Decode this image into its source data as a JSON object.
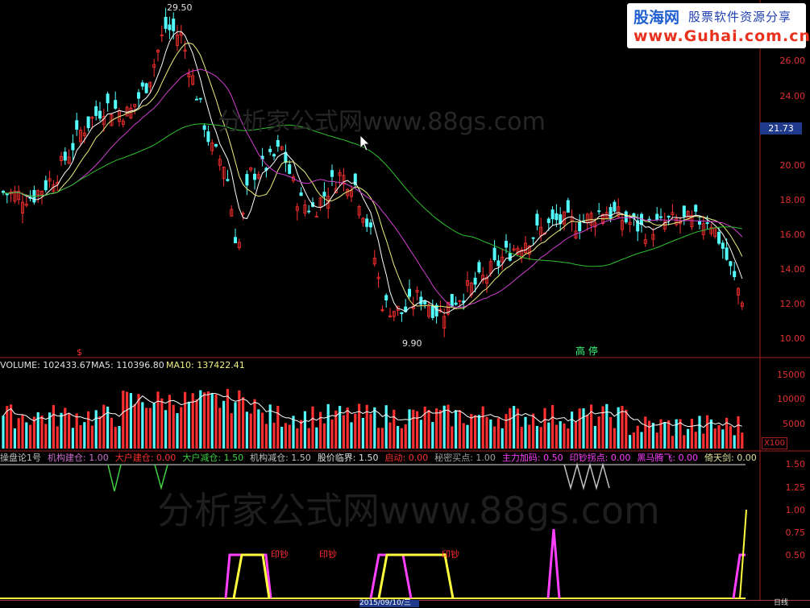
{
  "logo": {
    "brand": "股海网",
    "slogan": "股票软件资源分享",
    "url": "www.Guhai.com.cn"
  },
  "watermarks": {
    "top": "分析家公式网www.88gs.com",
    "bottom": "分析家公式网www.88gs.com"
  },
  "price_panel": {
    "axis_ticks": [
      "26.00",
      "24.00",
      "20.00",
      "18.00",
      "16.00",
      "14.00",
      "12.00",
      "10.00"
    ],
    "current_price": "21.73",
    "high_label": "29.50",
    "low_label": "9.90",
    "signal_label": "高 停",
    "dollar_marker": "$"
  },
  "volume_panel": {
    "legend": {
      "volume": "VOLUME: 102433.67",
      "ma5": "MA5: 110396.80",
      "ma10": "MA10: 137422.41"
    },
    "axis_ticks": [
      "15000",
      "10000",
      "5000"
    ],
    "unit": "X100"
  },
  "indicator_panel": {
    "legend": [
      {
        "text": "操盘论1号",
        "color": "#c0c0c0"
      },
      {
        "text": "机构建仓: 1.00",
        "color": "#d070d0"
      },
      {
        "text": "大户建仓: 0.00",
        "color": "#ff3030"
      },
      {
        "text": "大户减仓: 1.50",
        "color": "#40d040"
      },
      {
        "text": "机构减仓: 1.50",
        "color": "#c0c0c0"
      },
      {
        "text": "股价临界: 1.50",
        "color": "#e0e0e0"
      },
      {
        "text": "启动: 0.00",
        "color": "#ff3030"
      },
      {
        "text": "秘密买点: 1.00",
        "color": "#a0a0a0"
      },
      {
        "text": "主力加码: 0.50",
        "color": "#ff40ff"
      },
      {
        "text": "印钞拐点: 0.00",
        "color": "#ff40ff"
      },
      {
        "text": "黑马腾飞: 0.00",
        "color": "#ff40ff"
      },
      {
        "text": "倚天剑: 0.00",
        "color": "#e0e0a0"
      }
    ],
    "axis_ticks": [
      "1.50",
      "1.25",
      "1.00",
      "0.75",
      "0.50"
    ],
    "marks": [
      "印钞",
      "印钞",
      "印钞"
    ]
  },
  "bottom_bar": {
    "date": "2015/09/10/三",
    "period": "日线"
  },
  "colors": {
    "up": "#ff3030",
    "down": "#54ffff",
    "ma_white": "#ffffff",
    "ma_yellow": "#f0f080",
    "ma_magenta": "#d040d0",
    "ma_green": "#30c030",
    "axis": "#a02020"
  }
}
